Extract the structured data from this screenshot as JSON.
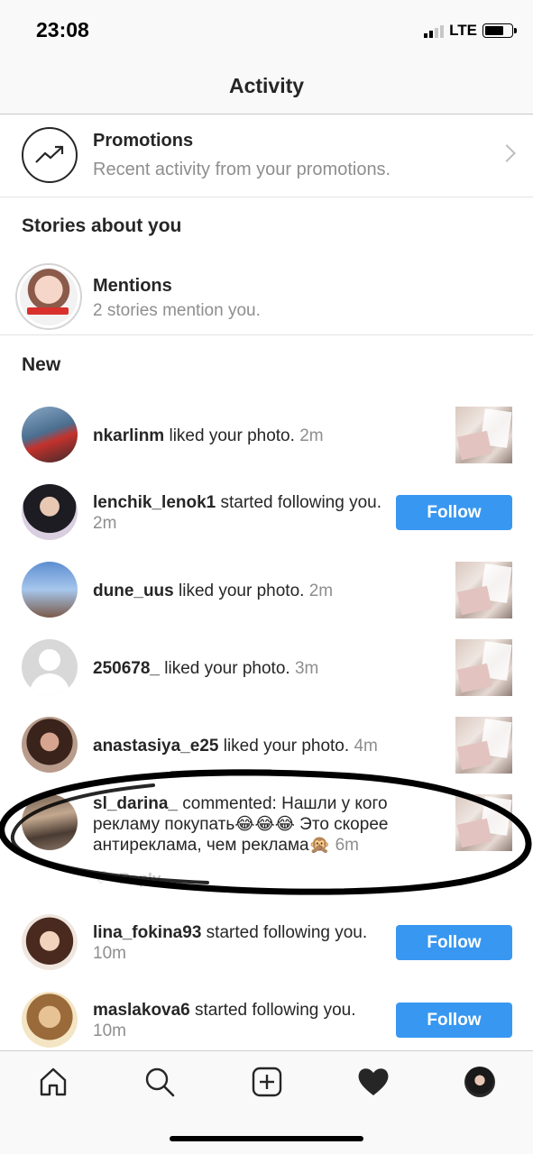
{
  "status_bar": {
    "time": "23:08",
    "network": "LTE"
  },
  "header": {
    "title": "Activity"
  },
  "promotions": {
    "title": "Promotions",
    "subtitle": "Recent activity from your promotions.",
    "icon": "trending-up-icon"
  },
  "stories": {
    "section_title": "Stories about you",
    "mentions_title": "Mentions",
    "mentions_subtitle": "2 stories mention you."
  },
  "new_section": {
    "title": "New"
  },
  "activities": [
    {
      "username": "nkarlinm",
      "action": " liked your photo. ",
      "time": "2m",
      "kind": "like"
    },
    {
      "username": "lenchik_lenok1",
      "action": " started following you. ",
      "time": "2m",
      "kind": "follow"
    },
    {
      "username": "dune_uus",
      "action": " liked your photo. ",
      "time": "2m",
      "kind": "like"
    },
    {
      "username": "250678_",
      "action": " liked your photo. ",
      "time": "3m",
      "kind": "like"
    },
    {
      "username": "anastasiya_e25",
      "action": " liked your photo. ",
      "time": "4m",
      "kind": "like"
    },
    {
      "username": "sl_darina_",
      "action": " commented: Нашли у кого рекламу покупать😂😂😂 Это скорее антиреклама, чем реклама🙊 ",
      "time": "6m",
      "kind": "comment"
    },
    {
      "username": "lina_fokina93",
      "action": " started following you. ",
      "time": "10m",
      "kind": "follow"
    },
    {
      "username": "maslakova6",
      "action": " started following you. ",
      "time": "10m",
      "kind": "follow"
    }
  ],
  "buttons": {
    "follow_label": "Follow",
    "reply_label": "Reply"
  },
  "tab_bar": {
    "items": [
      "home-icon",
      "search-icon",
      "add-post-icon",
      "activity-heart-icon",
      "profile-avatar"
    ]
  },
  "colors": {
    "accent": "#3897f0",
    "text": "#262626",
    "secondary": "#8e8e8e",
    "annotation": "#000000"
  }
}
